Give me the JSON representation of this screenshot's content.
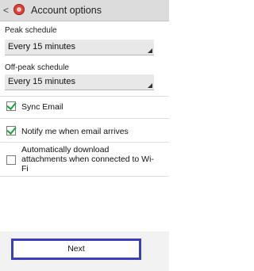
{
  "header": {
    "title": "Account options",
    "back_glyph": "<"
  },
  "peak": {
    "label": "Peak schedule",
    "value": "Every 15 minutes"
  },
  "offpeak": {
    "label": "Off-peak schedule",
    "value": "Every 15 minutes"
  },
  "options": [
    {
      "label": "Sync Email",
      "checked": true
    },
    {
      "label": "Notify me when email arrives",
      "checked": true
    },
    {
      "label_lines": [
        "Automatically download",
        "attachments when connected to Wi-",
        "Fi"
      ],
      "checked": false
    }
  ],
  "footer": {
    "next_label": "Next"
  },
  "colors": {
    "accent": "#3b3fb8",
    "check": "#1aa23c",
    "app_icon": "#d8403a"
  }
}
